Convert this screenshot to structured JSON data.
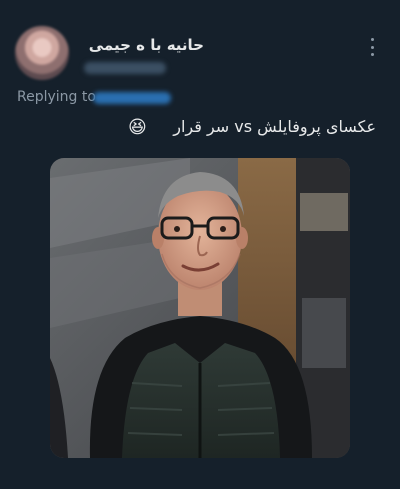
{
  "author": {
    "display_name": "حانیه با ه جیمی"
  },
  "reply": {
    "prefix": "Replying to"
  },
  "tweet": {
    "text": "عکسای پروفایلش vs سر قرار",
    "emoji": "😆"
  },
  "icons": {
    "more": "more-vertical-icon"
  },
  "colors": {
    "background": "#15202b",
    "primary_text": "#e7e9ea",
    "secondary_text": "#8b98a5",
    "accent": "#1d9bf0"
  }
}
